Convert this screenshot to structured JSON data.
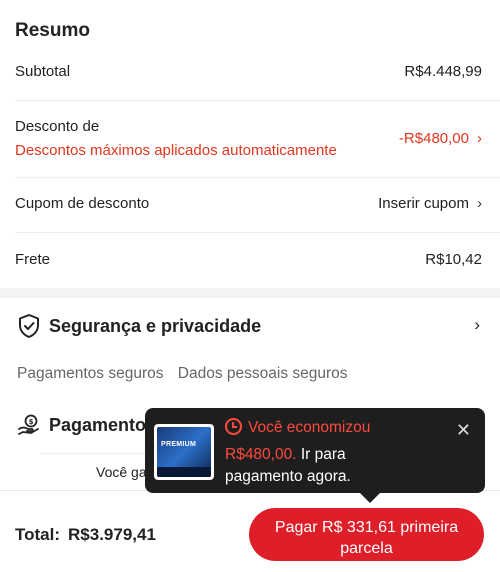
{
  "summary": {
    "title": "Resumo",
    "subtotal_label": "Subtotal",
    "subtotal_value": "R$4.448,99",
    "discount_label": "Desconto de",
    "discount_sub": "Descontos máximos aplicados automaticamente",
    "discount_value": "-R$480,00",
    "coupon_label": "Cupom de desconto",
    "coupon_action": "Inserir cupom",
    "shipping_label": "Frete",
    "shipping_value": "R$10,42"
  },
  "security": {
    "title": "Segurança e privacidade",
    "tags": [
      "Pagamentos seguros",
      "Dados pessoais seguros"
    ]
  },
  "payment": {
    "title": "Pagamento",
    "credit_text": "Você ganha R$88,98 créditos de compras"
  },
  "tooltip": {
    "headline": "Você economizou",
    "amount": "R$480,00.",
    "message": "Ir para pagamento agora.",
    "thumb_brand": "PREMIUM"
  },
  "footer": {
    "total_label": "Total:",
    "total_value": "R$3.979,41",
    "pay_button": "Pagar R$ 331,61 primeira parcela"
  },
  "colors": {
    "accent_red": "#de1f29",
    "discount_red": "#e0371f",
    "tooltip_bg": "#1e1e1e"
  }
}
